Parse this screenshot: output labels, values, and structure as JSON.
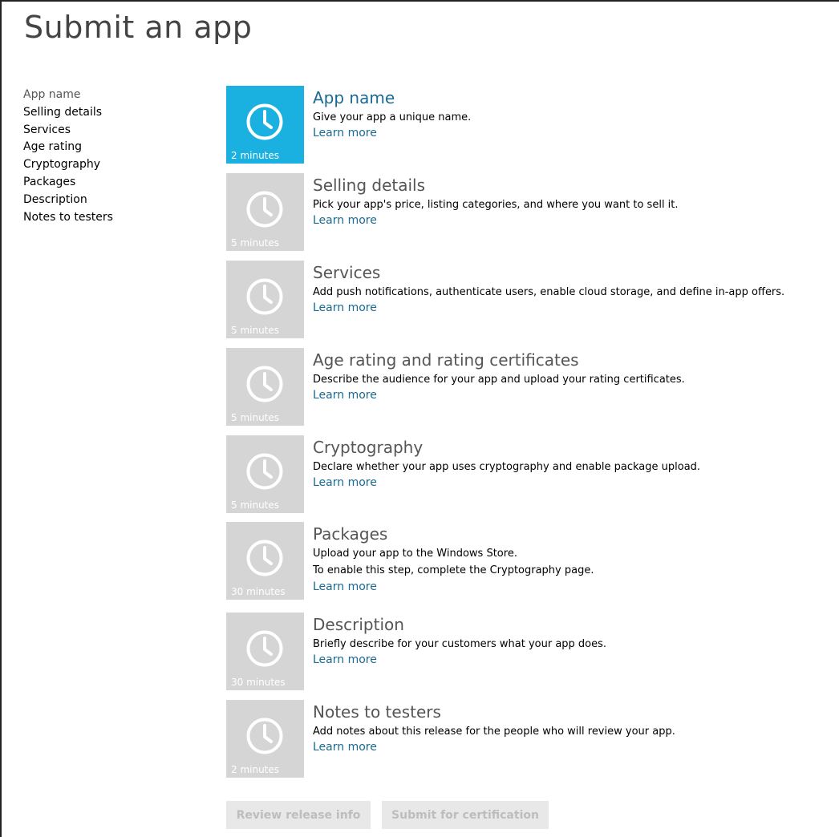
{
  "page": {
    "title": "Submit an app"
  },
  "sidebar": {
    "items": [
      {
        "label": "App name",
        "current": true
      },
      {
        "label": "Selling details"
      },
      {
        "label": "Services"
      },
      {
        "label": "Age rating"
      },
      {
        "label": "Cryptography"
      },
      {
        "label": "Packages"
      },
      {
        "label": "Description"
      },
      {
        "label": "Notes to testers"
      }
    ]
  },
  "steps": [
    {
      "title": "App name",
      "duration": "2 minutes",
      "active": true,
      "description": [
        "Give your app a unique name."
      ],
      "link": "Learn more"
    },
    {
      "title": "Selling details",
      "duration": "5 minutes",
      "description": [
        "Pick your app's price, listing categories, and where you want to sell it."
      ],
      "link": "Learn more"
    },
    {
      "title": "Services",
      "duration": "5 minutes",
      "description": [
        "Add push notifications, authenticate users, enable cloud storage, and define in-app offers."
      ],
      "link": "Learn more"
    },
    {
      "title": "Age rating and rating certificates",
      "duration": "5 minutes",
      "description": [
        "Describe the audience for your app and upload your rating certificates."
      ],
      "link": "Learn more"
    },
    {
      "title": "Cryptography",
      "duration": "5 minutes",
      "description": [
        "Declare whether your app uses cryptography and enable package upload."
      ],
      "link": "Learn more"
    },
    {
      "title": "Packages",
      "duration": "30 minutes",
      "description": [
        "Upload your app to the Windows Store.",
        "To enable this step, complete the Cryptography page."
      ],
      "link": "Learn more"
    },
    {
      "title": "Description",
      "duration": "30 minutes",
      "description": [
        "Briefly describe for your customers what your app does."
      ],
      "link": "Learn more"
    },
    {
      "title": "Notes to testers",
      "duration": "2 minutes",
      "description": [
        "Add notes about this release for the people who will review your app."
      ],
      "link": "Learn more"
    }
  ],
  "icons": {
    "tile": "clock-icon"
  },
  "colors": {
    "accent": "#1ab0e0",
    "link": "#1a6a93",
    "tile_disabled": "#d5d5d5",
    "button_disabled_bg": "#e8e8e8",
    "button_disabled_text": "#bdbdbd"
  },
  "actions": {
    "review_label": "Review release info",
    "submit_label": "Submit for certification"
  }
}
